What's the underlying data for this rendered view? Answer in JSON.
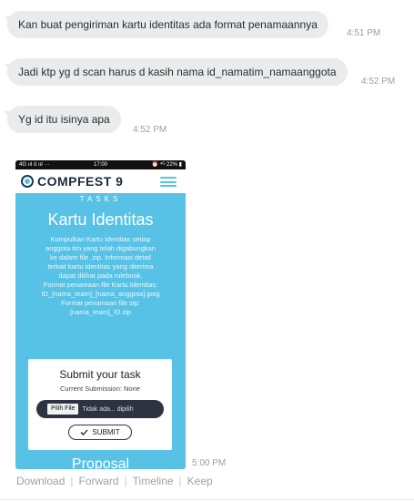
{
  "messages": [
    {
      "text": "Kan buat pengiriman kartu identitas ada format penamaannya",
      "time": "4:51 PM"
    },
    {
      "text": "Jadi ktp yg d scan harus d kasih nama id_namatim_namaanggota",
      "time": "4:52 PM"
    },
    {
      "text": "Yg id itu isinya apa",
      "time": "4:52 PM"
    }
  ],
  "image_message": {
    "time": "5:00 PM",
    "screenshot": {
      "status_left": "4G ııl ö ııl ···",
      "status_time": "17:00",
      "status_right": "⏰ ⁴ᴳ 22% ▮",
      "brand": "COMPFEST 9",
      "section": "TASKS",
      "title": "Kartu Identitas",
      "description": "Kumpulkan Kartu Identitas setiap\nanggota tim yang telah digabungkan\nke dalam file .zip. Informasi detail\nterkait kartu identitas yang diterima\ndapat dilihat pada rulebook.\nFormat penamaan file Kartu Identitas:\nID_[nama_team]_[nama_anggota].jpeg\nFormat penamaan file zip:\n[nama_team]_ID.zip",
      "card_title": "Submit your task",
      "current_submission": "Current Submission: None",
      "file_button": "Pilih File",
      "file_status": "Tidak ada... dipilih",
      "submit_label": "SUBMIT",
      "next_heading": "Proposal"
    }
  },
  "actions": [
    "Download",
    "Forward",
    "Timeline",
    "Keep"
  ]
}
